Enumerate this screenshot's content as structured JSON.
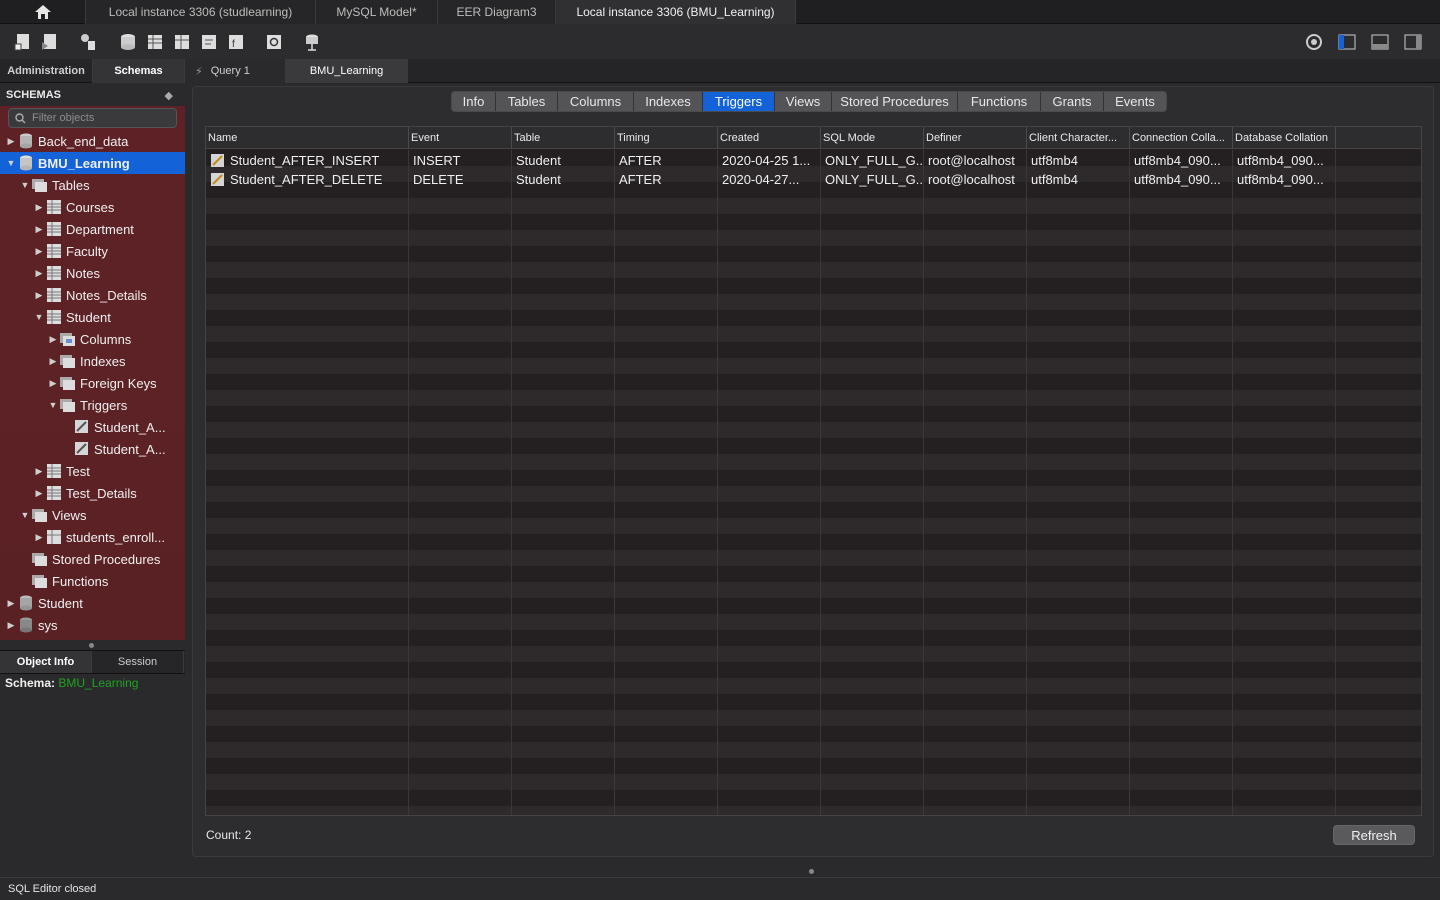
{
  "top_tabs": [
    {
      "label": "Local instance 3306 (studlearning)"
    },
    {
      "label": "MySQL Model*"
    },
    {
      "label": "EER Diagram3"
    },
    {
      "label": "Local instance 3306 (BMU_Learning)"
    }
  ],
  "nav_tabs": {
    "administration": "Administration",
    "schemas": "Schemas"
  },
  "query_tabs": [
    {
      "label": "Query 1"
    },
    {
      "label": "BMU_Learning"
    }
  ],
  "sidebar": {
    "header": "SCHEMAS",
    "filter_placeholder": "Filter objects",
    "tree": [
      {
        "label": "Back_end_data"
      },
      {
        "label": "BMU_Learning"
      },
      {
        "label": "Tables"
      },
      {
        "label": "Courses"
      },
      {
        "label": "Department"
      },
      {
        "label": "Faculty"
      },
      {
        "label": "Notes"
      },
      {
        "label": "Notes_Details"
      },
      {
        "label": "Student"
      },
      {
        "label": "Columns"
      },
      {
        "label": "Indexes"
      },
      {
        "label": "Foreign Keys"
      },
      {
        "label": "Triggers"
      },
      {
        "label": "Student_A..."
      },
      {
        "label": "Student_A..."
      },
      {
        "label": "Test"
      },
      {
        "label": "Test_Details"
      },
      {
        "label": "Views"
      },
      {
        "label": "students_enroll..."
      },
      {
        "label": "Stored Procedures"
      },
      {
        "label": "Functions"
      },
      {
        "label": "Student"
      },
      {
        "label": "sys"
      }
    ]
  },
  "object_tabs": {
    "object_info": "Object Info",
    "session": "Session"
  },
  "object_info": {
    "key": "Schema:",
    "value": "BMU_Learning"
  },
  "main": {
    "tabs": [
      "Info",
      "Tables",
      "Columns",
      "Indexes",
      "Triggers",
      "Views",
      "Stored Procedures",
      "Functions",
      "Grants",
      "Events"
    ],
    "active_tab": "Triggers",
    "columns": [
      "Name",
      "Event",
      "Table",
      "Timing",
      "Created",
      "SQL Mode",
      "Definer",
      "Client Character...",
      "Connection Colla...",
      "Database Collation"
    ],
    "rows": [
      [
        "Student_AFTER_INSERT",
        "INSERT",
        "Student",
        "AFTER",
        "2020-04-25 1...",
        "ONLY_FULL_G...",
        "root@localhost",
        "utf8mb4",
        "utf8mb4_090...",
        "utf8mb4_090..."
      ],
      [
        "Student_AFTER_DELETE",
        "DELETE",
        "Student",
        "AFTER",
        "2020-04-27...",
        "ONLY_FULL_G...",
        "root@localhost",
        "utf8mb4",
        "utf8mb4_090...",
        "utf8mb4_090..."
      ]
    ],
    "count_label": "Count: 2",
    "refresh_label": "Refresh"
  },
  "status_text": "SQL Editor closed",
  "colors": {
    "selection": "#1462d8",
    "sidebar_bg": "#5e2226",
    "schema_value": "#1fa31f"
  }
}
